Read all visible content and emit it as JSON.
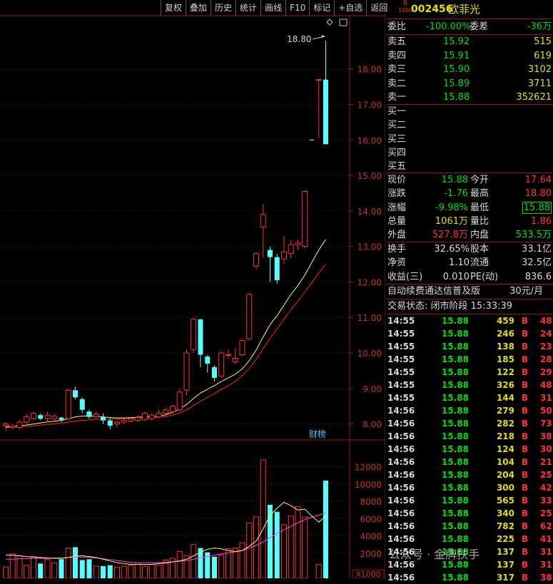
{
  "toolbar": [
    "复权",
    "叠加",
    "历史",
    "统计",
    "画线",
    "F10",
    "标记",
    "+自选",
    "返回"
  ],
  "chart_data": {
    "type": "candlestick",
    "price_axis": {
      "ticks": [
        8.0,
        9.0,
        10.0,
        11.0,
        12.0,
        13.0,
        14.0,
        15.0,
        16.0,
        17.0,
        18.0
      ],
      "range": [
        7.55,
        19.5
      ]
    },
    "max_label": "18.80",
    "finance_label": "财榜",
    "candles": [
      {
        "o": 7.95,
        "c": 8.0,
        "h": 8.05,
        "l": 7.8
      },
      {
        "o": 7.9,
        "c": 7.95,
        "h": 8.0,
        "l": 7.85
      },
      {
        "o": 7.9,
        "c": 8.05,
        "h": 8.1,
        "l": 7.85
      },
      {
        "o": 8.05,
        "c": 8.2,
        "h": 8.3,
        "l": 8.0
      },
      {
        "o": 8.15,
        "c": 8.3,
        "h": 8.35,
        "l": 8.1
      },
      {
        "o": 8.25,
        "c": 8.15,
        "h": 8.3,
        "l": 8.1
      },
      {
        "o": 8.15,
        "c": 8.25,
        "h": 8.35,
        "l": 8.05
      },
      {
        "o": 8.15,
        "c": 8.22,
        "h": 8.28,
        "l": 8.05
      },
      {
        "o": 8.18,
        "c": 8.12,
        "h": 8.2,
        "l": 8.05
      },
      {
        "o": 8.15,
        "c": 8.95,
        "h": 9.0,
        "l": 8.1
      },
      {
        "o": 8.95,
        "c": 8.75,
        "h": 9.05,
        "l": 8.7
      },
      {
        "o": 8.7,
        "c": 8.4,
        "h": 8.75,
        "l": 8.3
      },
      {
        "o": 8.35,
        "c": 8.2,
        "h": 8.4,
        "l": 8.15
      },
      {
        "o": 8.2,
        "c": 8.28,
        "h": 8.35,
        "l": 8.15
      },
      {
        "o": 8.2,
        "c": 8.1,
        "h": 8.3,
        "l": 8.0
      },
      {
        "o": 8.1,
        "c": 7.95,
        "h": 8.15,
        "l": 7.85
      },
      {
        "o": 8.0,
        "c": 8.05,
        "h": 8.1,
        "l": 7.9
      },
      {
        "o": 8.05,
        "c": 8.1,
        "h": 8.15,
        "l": 8.0
      },
      {
        "o": 8.08,
        "c": 8.15,
        "h": 8.2,
        "l": 8.05
      },
      {
        "o": 8.1,
        "c": 8.18,
        "h": 8.25,
        "l": 8.05
      },
      {
        "o": 8.12,
        "c": 8.3,
        "h": 8.35,
        "l": 8.1
      },
      {
        "o": 8.15,
        "c": 8.25,
        "h": 8.3,
        "l": 8.1
      },
      {
        "o": 8.2,
        "c": 8.3,
        "h": 8.4,
        "l": 8.15
      },
      {
        "o": 8.3,
        "c": 8.4,
        "h": 8.45,
        "l": 8.2
      },
      {
        "o": 8.35,
        "c": 8.5,
        "h": 8.55,
        "l": 8.3
      },
      {
        "o": 8.4,
        "c": 8.9,
        "h": 9.0,
        "l": 8.35
      },
      {
        "o": 8.95,
        "c": 10.0,
        "h": 10.1,
        "l": 8.8
      },
      {
        "o": 10.1,
        "c": 10.95,
        "h": 10.98,
        "l": 10.0
      },
      {
        "o": 10.95,
        "c": 9.95,
        "h": 10.95,
        "l": 9.6
      },
      {
        "o": 9.9,
        "c": 9.7,
        "h": 9.95,
        "l": 9.45
      },
      {
        "o": 9.6,
        "c": 9.3,
        "h": 9.65,
        "l": 9.2
      },
      {
        "o": 9.35,
        "c": 10.0,
        "h": 10.05,
        "l": 9.3
      },
      {
        "o": 9.95,
        "c": 9.95,
        "h": 10.1,
        "l": 9.85
      },
      {
        "o": 9.75,
        "c": 9.85,
        "h": 10.15,
        "l": 9.7
      },
      {
        "o": 9.95,
        "c": 10.35,
        "h": 10.4,
        "l": 9.9
      },
      {
        "o": 10.4,
        "c": 11.65,
        "h": 11.7,
        "l": 10.35
      },
      {
        "o": 12.45,
        "c": 12.8,
        "h": 12.85,
        "l": 12.35
      },
      {
        "o": 13.55,
        "c": 13.9,
        "h": 14.2,
        "l": 12.7
      },
      {
        "o": 12.9,
        "c": 12.7,
        "h": 13.0,
        "l": 12.0
      },
      {
        "o": 12.7,
        "c": 12.05,
        "h": 12.8,
        "l": 11.95
      },
      {
        "o": 12.65,
        "c": 12.85,
        "h": 13.3,
        "l": 12.5
      },
      {
        "o": 12.8,
        "c": 13.05,
        "h": 13.2,
        "l": 12.65
      },
      {
        "o": 13.05,
        "c": 13.1,
        "h": 13.2,
        "l": 12.9
      },
      {
        "o": 13.0,
        "c": 14.55,
        "h": 14.6,
        "l": 12.95
      },
      {
        "o": 16.0,
        "c": 16.0,
        "h": 16.0,
        "l": 16.0
      },
      {
        "o": 17.7,
        "c": 17.7,
        "h": 17.7,
        "l": 16.05
      },
      {
        "o": 17.7,
        "c": 15.88,
        "h": 18.8,
        "l": 15.88
      }
    ],
    "ma_yellow": [
      7.92,
      7.93,
      7.95,
      7.97,
      8.0,
      8.03,
      8.06,
      8.08,
      8.1,
      8.15,
      8.2,
      8.22,
      8.23,
      8.22,
      8.2,
      8.18,
      8.17,
      8.17,
      8.18,
      8.19,
      8.2,
      8.21,
      8.22,
      8.26,
      8.33,
      8.42,
      8.55,
      8.72,
      8.87,
      8.98,
      9.08,
      9.2,
      9.3,
      9.4,
      9.55,
      9.78,
      10.08,
      10.45,
      10.8,
      11.05,
      11.35,
      11.65,
      11.9,
      12.2,
      12.55,
      12.9,
      13.2
    ],
    "ma_red": [
      7.9,
      7.91,
      7.92,
      7.93,
      7.95,
      7.97,
      7.99,
      8.01,
      8.02,
      8.05,
      8.08,
      8.1,
      8.12,
      8.13,
      8.14,
      8.14,
      8.14,
      8.15,
      8.16,
      8.17,
      8.18,
      8.18,
      8.19,
      8.21,
      8.25,
      8.31,
      8.4,
      8.52,
      8.64,
      8.75,
      8.86,
      8.97,
      9.08,
      9.2,
      9.36,
      9.56,
      9.82,
      10.12,
      10.42,
      10.68,
      10.95,
      11.22,
      11.46,
      11.72,
      11.98,
      12.25,
      12.5
    ],
    "volume_axis": {
      "ticks": [
        2000,
        4000,
        6000,
        8000,
        10000,
        12000
      ],
      "max": 14200,
      "unit": "X1000"
    },
    "volumes": [
      400,
      1900,
      1700,
      600,
      1600,
      800,
      1300,
      900,
      1300,
      2600,
      2700,
      1200,
      1300,
      500,
      500,
      600,
      400,
      500,
      600,
      900,
      500,
      700,
      600,
      1200,
      1400,
      2200,
      1700,
      3000,
      2600,
      2100,
      1600,
      1800,
      2500,
      2600,
      3200,
      5500,
      6200,
      12800,
      7600,
      6800,
      5300,
      6300,
      7400,
      6200,
      0,
      700,
      10400
    ],
    "vol_ma_yellow": [
      1800,
      1750,
      1700,
      1600,
      1550,
      1500,
      1450,
      1400,
      1400,
      1500,
      1650,
      1700,
      1600,
      1500,
      1300,
      1100,
      900,
      800,
      700,
      700,
      700,
      700,
      800,
      850,
      1000,
      1100,
      1300,
      1700,
      2100,
      2450,
      2600,
      2500,
      2300,
      2200,
      2300,
      2800,
      3400,
      4800,
      6400,
      7200,
      7900,
      7500,
      7000,
      7100,
      6300,
      5600,
      6300
    ],
    "vol_ma_magenta": [
      1300,
      1300,
      1350,
      1350,
      1400,
      1400,
      1400,
      1450,
      1450,
      1500,
      1550,
      1550,
      1500,
      1450,
      1350,
      1250,
      1150,
      1050,
      950,
      900,
      900,
      900,
      900,
      950,
      1000,
      1050,
      1150,
      1300,
      1450,
      1600,
      1800,
      1900,
      2050,
      2150,
      2300,
      2600,
      2900,
      3300,
      3800,
      4300,
      4700,
      5100,
      5500,
      5900,
      6200,
      6400,
      6700
    ]
  },
  "quote": {
    "badge_top": "R",
    "badge_bottom": "1000",
    "code": "002456",
    "name": "欧菲光",
    "wb_label": "委比",
    "wb_value": "-100.00%",
    "wc_label": "委差",
    "wc_value": "-36万",
    "asks": [
      {
        "label": "卖五",
        "price": "15.92",
        "vol": "515"
      },
      {
        "label": "卖四",
        "price": "15.91",
        "vol": "619"
      },
      {
        "label": "卖三",
        "price": "15.90",
        "vol": "3102"
      },
      {
        "label": "卖二",
        "price": "15.89",
        "vol": "3711"
      },
      {
        "label": "卖一",
        "price": "15.88",
        "vol": "352621"
      }
    ],
    "bids": [
      {
        "label": "买一",
        "price": "",
        "vol": ""
      },
      {
        "label": "买二",
        "price": "",
        "vol": ""
      },
      {
        "label": "买三",
        "price": "",
        "vol": ""
      },
      {
        "label": "买四",
        "price": "",
        "vol": ""
      },
      {
        "label": "买五",
        "price": "",
        "vol": ""
      }
    ],
    "stats1": [
      {
        "l1": "现价",
        "v1": "15.88",
        "c1": "g",
        "l2": "今开",
        "v2": "17.64",
        "c2": "r"
      },
      {
        "l1": "涨跌",
        "v1": "-1.76",
        "c1": "g",
        "l2": "最高",
        "v2": "18.80",
        "c2": "r"
      },
      {
        "l1": "涨幅",
        "v1": "-9.98%",
        "c1": "g",
        "l2": "最低",
        "v2": "15.88",
        "c2": "gbox"
      },
      {
        "l1": "总量",
        "v1": "1061万",
        "c1": "y",
        "l2": "量比",
        "v2": "1.86",
        "c2": "r"
      },
      {
        "l1": "外盘",
        "v1": "527.8万",
        "c1": "r",
        "l2": "内盘",
        "v2": "533.5万",
        "c2": "g"
      }
    ],
    "stats2": [
      {
        "l1": "换手",
        "v1": "32.65%",
        "l2": "股本",
        "v2": "33.1亿"
      },
      {
        "l1": "净资",
        "v1": "1.10",
        "l2": "流通",
        "v2": "32.5亿"
      },
      {
        "l1": "收益(三)",
        "v1": "0.010",
        "l2": "PE(动)",
        "v2": "836.6"
      }
    ],
    "ad_text": "自动续费通达信普及版",
    "ad_price": "30元/月",
    "status_text": "交易状态: 闭市阶段 15:33:39"
  },
  "trades": [
    {
      "t": "14:55",
      "p": "15.88",
      "v": "459",
      "s": "B",
      "n": "48"
    },
    {
      "t": "14:55",
      "p": "15.88",
      "v": "246",
      "s": "B",
      "n": "24"
    },
    {
      "t": "14:55",
      "p": "15.88",
      "v": "138",
      "s": "B",
      "n": "23"
    },
    {
      "t": "14:55",
      "p": "15.88",
      "v": "185",
      "s": "B",
      "n": "28"
    },
    {
      "t": "14:55",
      "p": "15.88",
      "v": "122",
      "s": "B",
      "n": "29"
    },
    {
      "t": "14:55",
      "p": "15.88",
      "v": "326",
      "s": "B",
      "n": "48"
    },
    {
      "t": "14:55",
      "p": "15.88",
      "v": "144",
      "s": "B",
      "n": "31"
    },
    {
      "t": "14:56",
      "p": "15.88",
      "v": "279",
      "s": "B",
      "n": "50"
    },
    {
      "t": "14:56",
      "p": "15.88",
      "v": "282",
      "s": "B",
      "n": "73"
    },
    {
      "t": "14:56",
      "p": "15.88",
      "v": "218",
      "s": "B",
      "n": "38"
    },
    {
      "t": "14:56",
      "p": "15.88",
      "v": "124",
      "s": "B",
      "n": "30"
    },
    {
      "t": "14:56",
      "p": "15.88",
      "v": "104",
      "s": "B",
      "n": "21"
    },
    {
      "t": "14:56",
      "p": "15.88",
      "v": "204",
      "s": "B",
      "n": "25"
    },
    {
      "t": "14:56",
      "p": "15.88",
      "v": "300",
      "s": "B",
      "n": "42"
    },
    {
      "t": "14:56",
      "p": "15.88",
      "v": "565",
      "s": "B",
      "n": "33"
    },
    {
      "t": "14:56",
      "p": "15.88",
      "v": "340",
      "s": "B",
      "n": "25"
    },
    {
      "t": "14:56",
      "p": "15.88",
      "v": "782",
      "s": "B",
      "n": "62"
    },
    {
      "t": "14:56",
      "p": "15.88",
      "v": "225",
      "s": "B",
      "n": "41"
    },
    {
      "t": "14:56",
      "p": "15.88",
      "v": "137",
      "s": "B",
      "n": "31"
    },
    {
      "t": "14:56",
      "p": "15.88",
      "v": "137",
      "s": "B",
      "n": "31"
    },
    {
      "t": "14:56",
      "p": "15.88",
      "v": "317",
      "s": "B",
      "n": "38"
    }
  ],
  "watermark": "公众号 · 金牌扶手"
}
